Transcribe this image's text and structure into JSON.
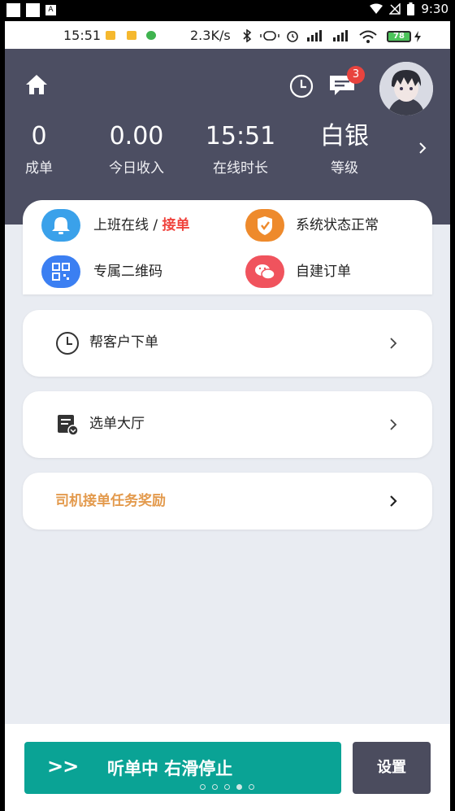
{
  "system_bar": {
    "time": "9:30"
  },
  "inner_status": {
    "time": "15:51",
    "net_speed": "2.3K/s",
    "battery": "78"
  },
  "header": {
    "message_badge": "3",
    "stats": [
      {
        "value": "0",
        "label": "成单"
      },
      {
        "value": "0.00",
        "label": "今日收入"
      },
      {
        "value": "15:51",
        "label": "在线时长"
      },
      {
        "value": "白银",
        "label": "等级"
      }
    ]
  },
  "status_card": {
    "online_label": "上班在线 / ",
    "online_accent": "接单",
    "system_status": "系统状态正常",
    "qrcode": "专属二维码",
    "self_order": "自建订单"
  },
  "menu": {
    "help_order": "帮客户下单",
    "order_hall": "选单大厅",
    "driver_reward": "司机接单任务奖励"
  },
  "bottom": {
    "slider_arrows": ">>",
    "slider_text": "听单中 右滑停止",
    "settings": "设置",
    "dots": {
      "count": 5,
      "active_index": 3
    }
  },
  "colors": {
    "header_bg": "#4c4e62",
    "accent_red": "#f0443e",
    "reward_orange": "#e39a4d",
    "slider_teal": "#0aa395",
    "settings_bg": "#4b4c5e"
  }
}
